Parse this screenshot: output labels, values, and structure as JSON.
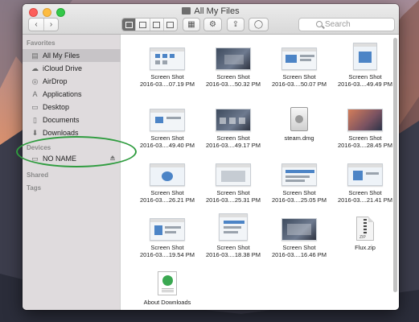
{
  "window": {
    "title": "All My Files"
  },
  "toolbar": {
    "back_glyph": "‹",
    "forward_glyph": "›",
    "arrange_glyph": "▦",
    "action_glyph": "⚙",
    "share_glyph": "⇪",
    "tag_glyph": "◯",
    "search_placeholder": "Search"
  },
  "sidebar": {
    "favorites_title": "Favorites",
    "favorites": [
      {
        "label": "All My Files",
        "icon": "all-files-icon",
        "glyph": "▤"
      },
      {
        "label": "iCloud Drive",
        "icon": "cloud-icon",
        "glyph": "☁"
      },
      {
        "label": "AirDrop",
        "icon": "airdrop-icon",
        "glyph": "◎"
      },
      {
        "label": "Applications",
        "icon": "applications-icon",
        "glyph": "A"
      },
      {
        "label": "Desktop",
        "icon": "desktop-icon",
        "glyph": "▭"
      },
      {
        "label": "Documents",
        "icon": "documents-icon",
        "glyph": "▯"
      },
      {
        "label": "Downloads",
        "icon": "downloads-icon",
        "glyph": "⬇"
      }
    ],
    "devices_title": "Devices",
    "devices": [
      {
        "label": "NO NAME",
        "icon": "drive-icon",
        "glyph": "▭"
      }
    ],
    "shared_title": "Shared",
    "tags_title": "Tags"
  },
  "files": [
    {
      "line1": "Screen Shot",
      "line2": "2016-03....07.19 PM",
      "kind": "screenshot"
    },
    {
      "line1": "Screen Shot",
      "line2": "2016-03....50.32 PM",
      "kind": "screenshot-dark"
    },
    {
      "line1": "Screen Shot",
      "line2": "2016-03....50.07 PM",
      "kind": "screenshot"
    },
    {
      "line1": "Screen Shot",
      "line2": "2016-03....49.49 PM",
      "kind": "screenshot-blue"
    },
    {
      "line1": "Screen Shot",
      "line2": "2016-03....49.40 PM",
      "kind": "screenshot"
    },
    {
      "line1": "Screen Shot",
      "line2": "2016-03....49.17 PM",
      "kind": "screenshot-dark"
    },
    {
      "line1": "steam.dmg",
      "line2": "",
      "kind": "disk-image"
    },
    {
      "line1": "Screen Shot",
      "line2": "2016-03....28.45 PM",
      "kind": "screenshot-warm"
    },
    {
      "line1": "Screen Shot",
      "line2": "2016-03....26.21 PM",
      "kind": "screenshot-blue"
    },
    {
      "line1": "Screen Shot",
      "line2": "2016-03....25.31 PM",
      "kind": "screenshot"
    },
    {
      "line1": "Screen Shot",
      "line2": "2016-03....25.05 PM",
      "kind": "screenshot"
    },
    {
      "line1": "Screen Shot",
      "line2": "2016-03....21.41 PM",
      "kind": "screenshot-blue"
    },
    {
      "line1": "Screen Shot",
      "line2": "2016-03....19.54 PM",
      "kind": "screenshot"
    },
    {
      "line1": "Screen Shot",
      "line2": "2016-03....18.38 PM",
      "kind": "screenshot"
    },
    {
      "line1": "Screen Shot",
      "line2": "2016-03....16.46 PM",
      "kind": "screenshot-dark"
    },
    {
      "line1": "Flux.zip",
      "line2": "",
      "kind": "zip-archive",
      "ext": "ZIP"
    },
    {
      "line1": "About Downloads",
      "line2": "",
      "kind": "pdf-document"
    }
  ],
  "colors": {
    "annotation_circle": "#2f9c3f",
    "sidebar_selected": "#c7c4c7"
  }
}
